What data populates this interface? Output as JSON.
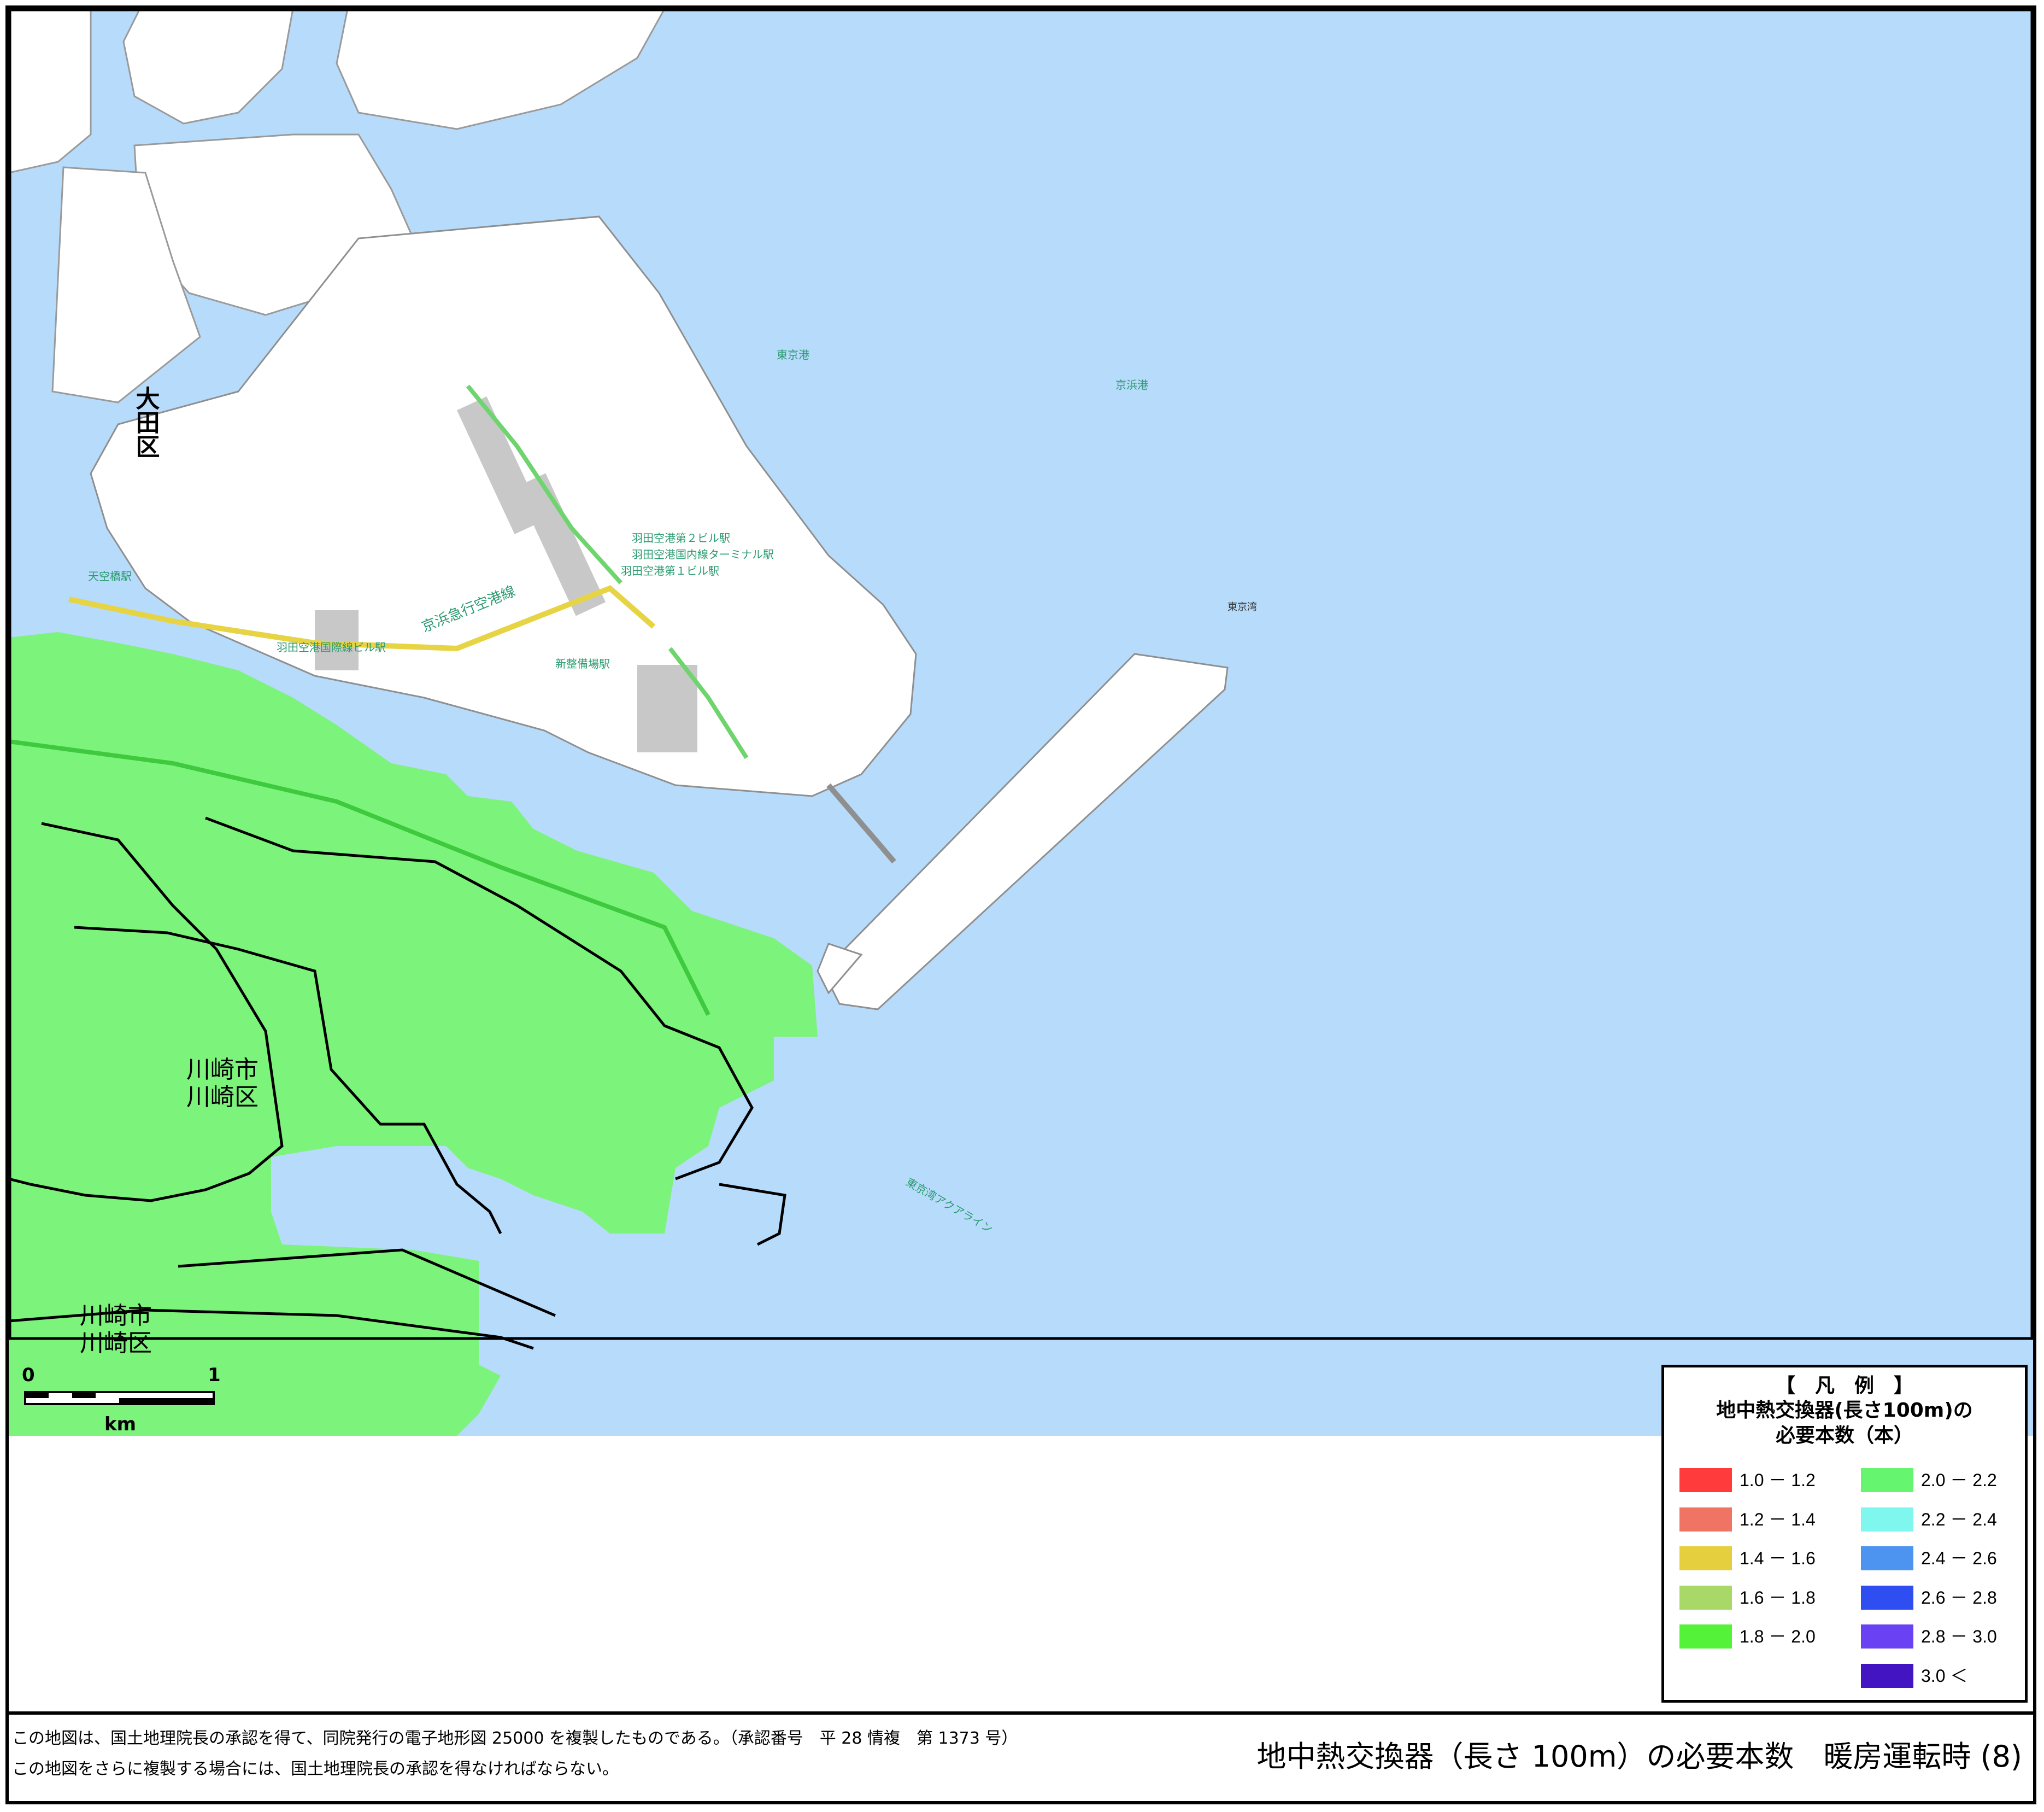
{
  "map": {
    "water_color": "#b7dbfb",
    "land_color": "#ffffff",
    "heat_zone_color": "#7cf37a",
    "labels": {
      "ota_ward": "大田区",
      "kawasaki_ward_1": "川崎市\n川崎区",
      "kawasaki_ward_2": "川崎市\n川崎区",
      "tokyo_bay": "東京湾",
      "tokyo_port": "東京港",
      "keihin_port": "京浜港",
      "haneda_line": "京浜急行空港線",
      "terminal2_station": "羽田空港第２ビル駅",
      "terminal_station": "羽田空港国内線ターミナル駅",
      "terminal1_station": "羽田空港第１ビル駅",
      "intl_station": "羽田空港国際線ビル駅",
      "seibijo_station": "新整備場駅",
      "tenkubashi_station": "天空橋駅",
      "aqua_line": "東京湾アクアライン"
    },
    "scale": {
      "start": "0",
      "end": "1",
      "unit": "km"
    }
  },
  "legend": {
    "title": "【　凡　例　】",
    "subtitle_1": "地中熱交換器(長さ100m)の",
    "subtitle_2": "必要本数（本）",
    "items": [
      {
        "label": "1.0 － 1.2",
        "color": "#ff3b3b"
      },
      {
        "label": "1.2 － 1.4",
        "color": "#ef7464"
      },
      {
        "label": "1.4 － 1.6",
        "color": "#e6cf3e"
      },
      {
        "label": "1.6 － 1.8",
        "color": "#a8d968"
      },
      {
        "label": "1.8 － 2.0",
        "color": "#55f23a"
      },
      {
        "label": "2.0 － 2.2",
        "color": "#65f56f"
      },
      {
        "label": "2.2 － 2.4",
        "color": "#7ff7ef"
      },
      {
        "label": "2.4 － 2.6",
        "color": "#4d94f0"
      },
      {
        "label": "2.6 － 2.8",
        "color": "#2f4ef2"
      },
      {
        "label": "2.8 － 3.0",
        "color": "#6a42f3"
      },
      {
        "label": "3.0 ＜",
        "color": "#4315c2"
      }
    ]
  },
  "footer": {
    "note_1": "この地図は、国土地理院長の承認を得て、同院発行の電子地形図 25000 を複製したものである。（承認番号　平 28 情複　第 1373 号）",
    "note_2": "この地図をさらに複製する場合には、国土地理院長の承認を得なければならない。",
    "title": "地中熱交換器（長さ 100m）の必要本数　暖房運転時 (8)"
  }
}
